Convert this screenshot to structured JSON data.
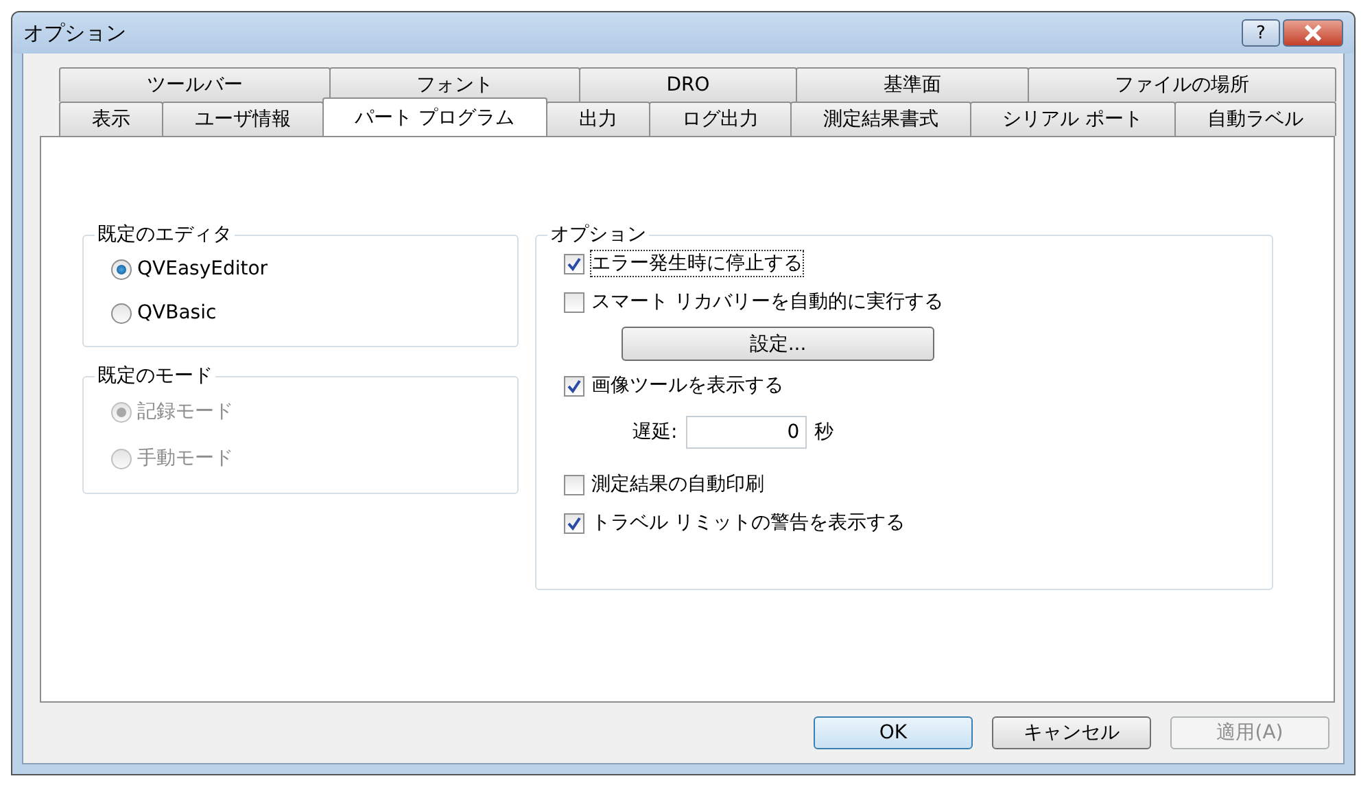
{
  "window": {
    "title": "オプション",
    "buttons": [
      {
        "kind": "help",
        "label": "?"
      },
      {
        "kind": "close"
      }
    ]
  },
  "tab_rows": [
    {
      "tabs": [
        {
          "label": "ツールバー",
          "selected": false
        },
        {
          "label": "フォント",
          "selected": false
        },
        {
          "label": "DRO",
          "selected": false
        },
        {
          "label": "基準面",
          "selected": false
        },
        {
          "label": "ファイルの場所",
          "selected": false
        }
      ]
    },
    {
      "tabs": [
        {
          "label": "表示",
          "selected": false
        },
        {
          "label": "ユーザ情報",
          "selected": false
        },
        {
          "label": "パート プログラム",
          "selected": true
        },
        {
          "label": "出力",
          "selected": false
        },
        {
          "label": "ログ出力",
          "selected": false
        },
        {
          "label": "測定結果書式",
          "selected": false
        },
        {
          "label": "シリアル ポート",
          "selected": false
        },
        {
          "label": "自動ラベル",
          "selected": false
        }
      ]
    }
  ],
  "default_editor": {
    "title": "既定のエディタ",
    "options": [
      {
        "label": "QVEasyEditor",
        "selected": true,
        "disabled": false
      },
      {
        "label": "QVBasic",
        "selected": false,
        "disabled": false
      }
    ]
  },
  "default_mode": {
    "title": "既定のモード",
    "options": [
      {
        "label": "記録モード",
        "selected": true,
        "disabled": true
      },
      {
        "label": "手動モード",
        "selected": false,
        "disabled": true
      }
    ]
  },
  "options": {
    "title": "オプション",
    "items": [
      {
        "kind": "checkbox",
        "label": "エラー発生時に停止する",
        "checked": true,
        "focused": true
      },
      {
        "kind": "checkbox",
        "label": "スマート リカバリーを自動的に実行する",
        "checked": false,
        "focused": false
      },
      {
        "kind": "button",
        "label": "設定..."
      },
      {
        "kind": "checkbox",
        "label": "画像ツールを表示する",
        "checked": true,
        "focused": false
      },
      {
        "kind": "field",
        "label": "遅延:",
        "value": "0",
        "unit": "秒"
      },
      {
        "kind": "checkbox",
        "label": "測定結果の自動印刷",
        "checked": false,
        "focused": false
      },
      {
        "kind": "checkbox",
        "label": "トラベル リミットの警告を表示する",
        "checked": true,
        "focused": false
      }
    ]
  },
  "footer_buttons": [
    {
      "label": "OK",
      "default": true,
      "disabled": false
    },
    {
      "label": "キャンセル",
      "default": false,
      "disabled": false
    },
    {
      "label": "適用(A)",
      "default": false,
      "disabled": true
    }
  ]
}
